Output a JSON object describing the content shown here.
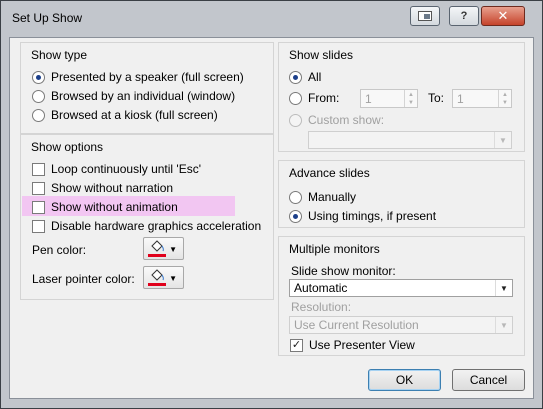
{
  "window": {
    "title": "Set Up Show",
    "help_label": "?",
    "close_label": "✕"
  },
  "show_type": {
    "title": "Show type",
    "options": [
      {
        "label": "Presented by a speaker (full screen)",
        "selected": true
      },
      {
        "label": "Browsed by an individual (window)",
        "selected": false
      },
      {
        "label": "Browsed at a kiosk (full screen)",
        "selected": false
      }
    ]
  },
  "show_options": {
    "title": "Show options",
    "checks": [
      {
        "label": "Loop continuously until 'Esc'",
        "checked": false
      },
      {
        "label": "Show without narration",
        "checked": false
      },
      {
        "label": "Show without animation",
        "checked": false
      },
      {
        "label": "Disable hardware graphics acceleration",
        "checked": false
      }
    ],
    "pen_color_label": "Pen color:",
    "laser_color_label": "Laser pointer color:",
    "pen_color": "#e0001b",
    "laser_color": "#e0001b",
    "highlight_color": "#f2c6f2"
  },
  "show_slides": {
    "title": "Show slides",
    "all_label": "All",
    "from_label": "From:",
    "from_value": "1",
    "to_label": "To:",
    "to_value": "1",
    "custom_label": "Custom show:",
    "custom_value": ""
  },
  "advance_slides": {
    "title": "Advance slides",
    "manually_label": "Manually",
    "timings_label": "Using timings, if present"
  },
  "monitors": {
    "title": "Multiple monitors",
    "monitor_label": "Slide show monitor:",
    "monitor_value": "Automatic",
    "resolution_label": "Resolution:",
    "resolution_value": "Use Current Resolution",
    "presenter_view_label": "Use Presenter View",
    "presenter_view_checked": true
  },
  "buttons": {
    "ok_label": "OK",
    "cancel_label": "Cancel"
  }
}
